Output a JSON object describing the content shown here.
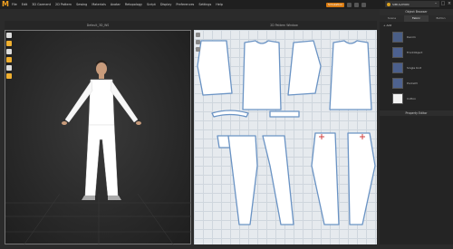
{
  "menubar": {
    "logo": "M",
    "items": [
      "File",
      "Edit",
      "3D Garment",
      "2D Pattern",
      "Sewing",
      "Materials",
      "Avatar",
      "Retopology",
      "Script",
      "Display",
      "Preferences",
      "Settings",
      "Help"
    ],
    "simulation_label": "Simulation"
  },
  "user": {
    "name": "SIMULATION"
  },
  "window": {
    "minimize": "–",
    "maximize": "□",
    "close": "×"
  },
  "view3d": {
    "title": "Default_3D_WS"
  },
  "view2d": {
    "title": "2D Pattern Window"
  },
  "object_browser": {
    "title": "Object Browser",
    "tabs": [
      "Scene",
      "Fabric",
      "Button"
    ],
    "active_tab": "Fabric",
    "section_label": "+ Add",
    "fabrics": [
      {
        "name": "Denim",
        "color": "#4a5e86"
      },
      {
        "name": "FrontObject",
        "color": "#4d6190"
      },
      {
        "name": "Single Knit",
        "color": "#4b5f8c"
      },
      {
        "name": "Pocket3",
        "color": "#4e628f"
      },
      {
        "name": "Cotton",
        "color": "#f2f2f2"
      }
    ]
  },
  "property_editor": {
    "title": "Property Editor"
  },
  "colors": {
    "accent": "#d87a10",
    "pattern_fill": "#ffffff",
    "pattern_outline": "#6a93c4",
    "grid_bg": "#e6eaee"
  }
}
